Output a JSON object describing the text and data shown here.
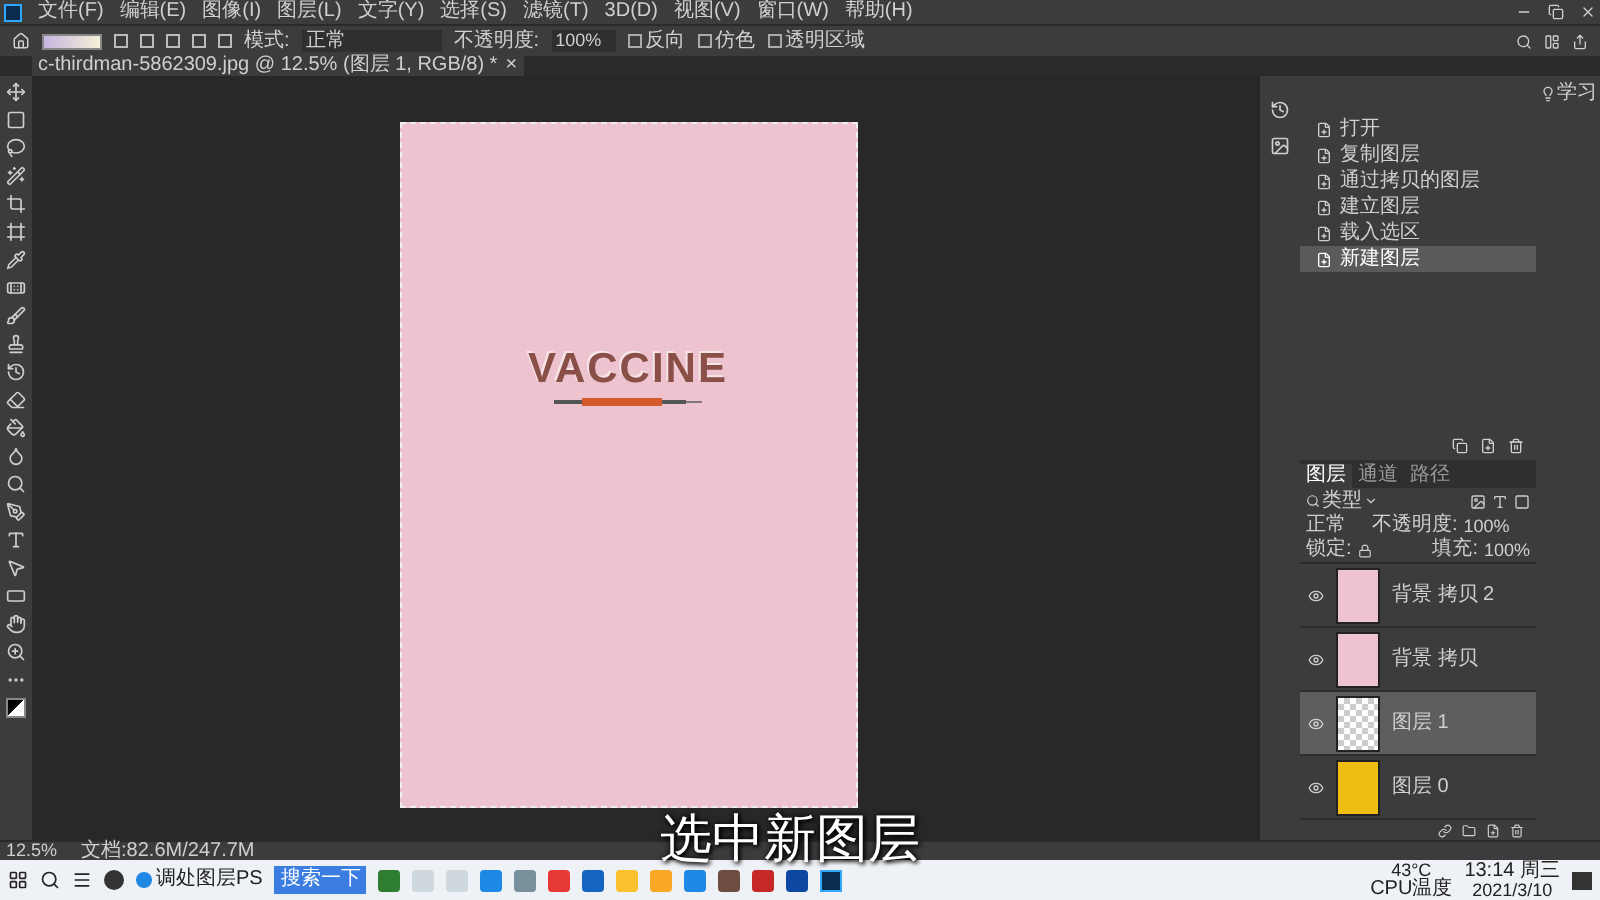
{
  "menu_bar": {
    "items": [
      "文件(F)",
      "编辑(E)",
      "图像(I)",
      "图层(L)",
      "文字(Y)",
      "选择(S)",
      "滤镜(T)",
      "3D(D)",
      "视图(V)",
      "窗口(W)",
      "帮助(H)"
    ]
  },
  "options_bar": {
    "mode_label": "模式:",
    "mode": "正常",
    "opacity_label": "不透明度:",
    "opacity": "100%",
    "checkboxes": [
      {
        "label": "反向",
        "checked": false
      },
      {
        "label": "仿色",
        "checked": false
      },
      {
        "label": "透明区域",
        "checked": false
      }
    ]
  },
  "document_tab": {
    "title": "c-thirdman-5862309.jpg @ 12.5% (图层 1, RGB/8) *",
    "close": "×"
  },
  "canvas": {
    "headline": "VACCINE"
  },
  "subtitle": "选中新图层",
  "history": {
    "items": [
      {
        "label": "打开",
        "selected": false
      },
      {
        "label": "复制图层",
        "selected": false
      },
      {
        "label": "通过拷贝的图层",
        "selected": false
      },
      {
        "label": "建立图层",
        "selected": false
      },
      {
        "label": "载入选区",
        "selected": false
      },
      {
        "label": "新建图层",
        "selected": true
      }
    ]
  },
  "learn_label": "学习",
  "layers_panel": {
    "tabs": [
      {
        "label": "图层",
        "selected": true
      },
      {
        "label": "通道",
        "selected": false
      },
      {
        "label": "路径",
        "selected": false
      }
    ],
    "filter": "类型",
    "blend_mode": "正常",
    "opacity_label": "不透明度:",
    "opacity": "100%",
    "lock_label": "锁定:",
    "fill_label": "填充:",
    "fill": "100%",
    "layers": [
      {
        "name": "背景 拷贝 2",
        "kind": "photo",
        "selected": false,
        "visible": true
      },
      {
        "name": "背景 拷贝",
        "kind": "photo",
        "selected": false,
        "visible": true
      },
      {
        "name": "图层 1",
        "kind": "transparent",
        "selected": true,
        "visible": true
      },
      {
        "name": "图层 0",
        "kind": "fill",
        "selected": false,
        "visible": true
      }
    ]
  },
  "status_bar": {
    "zoom": "12.5%",
    "document": "文档:82.6M/247.7M"
  },
  "taskbar": {
    "window_button": "调处图层PS",
    "search_button": "搜索一下",
    "temperature": "43°C",
    "temperature_label": "CPU温度",
    "time": "13:14 周三",
    "date": "2021/3/10"
  }
}
